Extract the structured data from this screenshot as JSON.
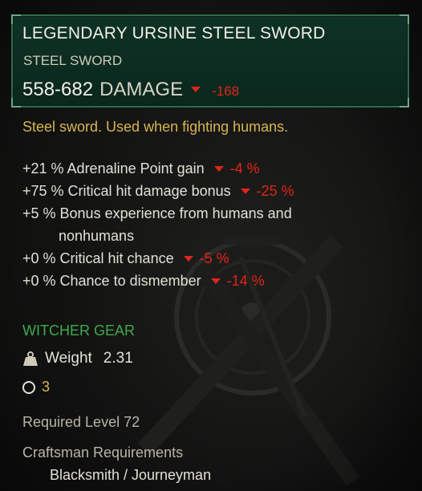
{
  "item": {
    "name": "LEGENDARY URSINE STEEL SWORD",
    "type": "STEEL SWORD",
    "damage_value": "558-682",
    "damage_label": "DAMAGE",
    "damage_delta": "-168",
    "description": "Steel sword. Used when fighting humans."
  },
  "stats": [
    {
      "text": "+21 % Adrenaline Point gain",
      "delta": "-4 %"
    },
    {
      "text": "+75 % Critical hit damage bonus",
      "delta": "-25 %"
    },
    {
      "text": "+5 % Bonus experience from humans and",
      "text_line2": "nonhumans"
    },
    {
      "text": "+0 % Critical hit chance",
      "delta": "-5 %"
    },
    {
      "text": "+0 % Chance to dismember",
      "delta": "-14 %"
    }
  ],
  "gear": {
    "label": "WITCHER GEAR",
    "weight_label": "Weight",
    "weight_value": "2.31",
    "slots": "3"
  },
  "requirements": {
    "level": "Required Level 72",
    "craftsman_title": "Craftsman Requirements",
    "craftsman_value": "Blacksmith / Journeyman"
  },
  "icons": {
    "decrease": "triangle-down-icon",
    "weight": "weight-icon",
    "slot": "circle-slot-icon"
  },
  "colors": {
    "header_bg": "#0f3226",
    "header_border": "#2f6a4f",
    "delta_red": "#e0241b",
    "description_gold": "#d9b453",
    "gear_green": "#3fa94e",
    "slot_gold": "#e0b548"
  }
}
